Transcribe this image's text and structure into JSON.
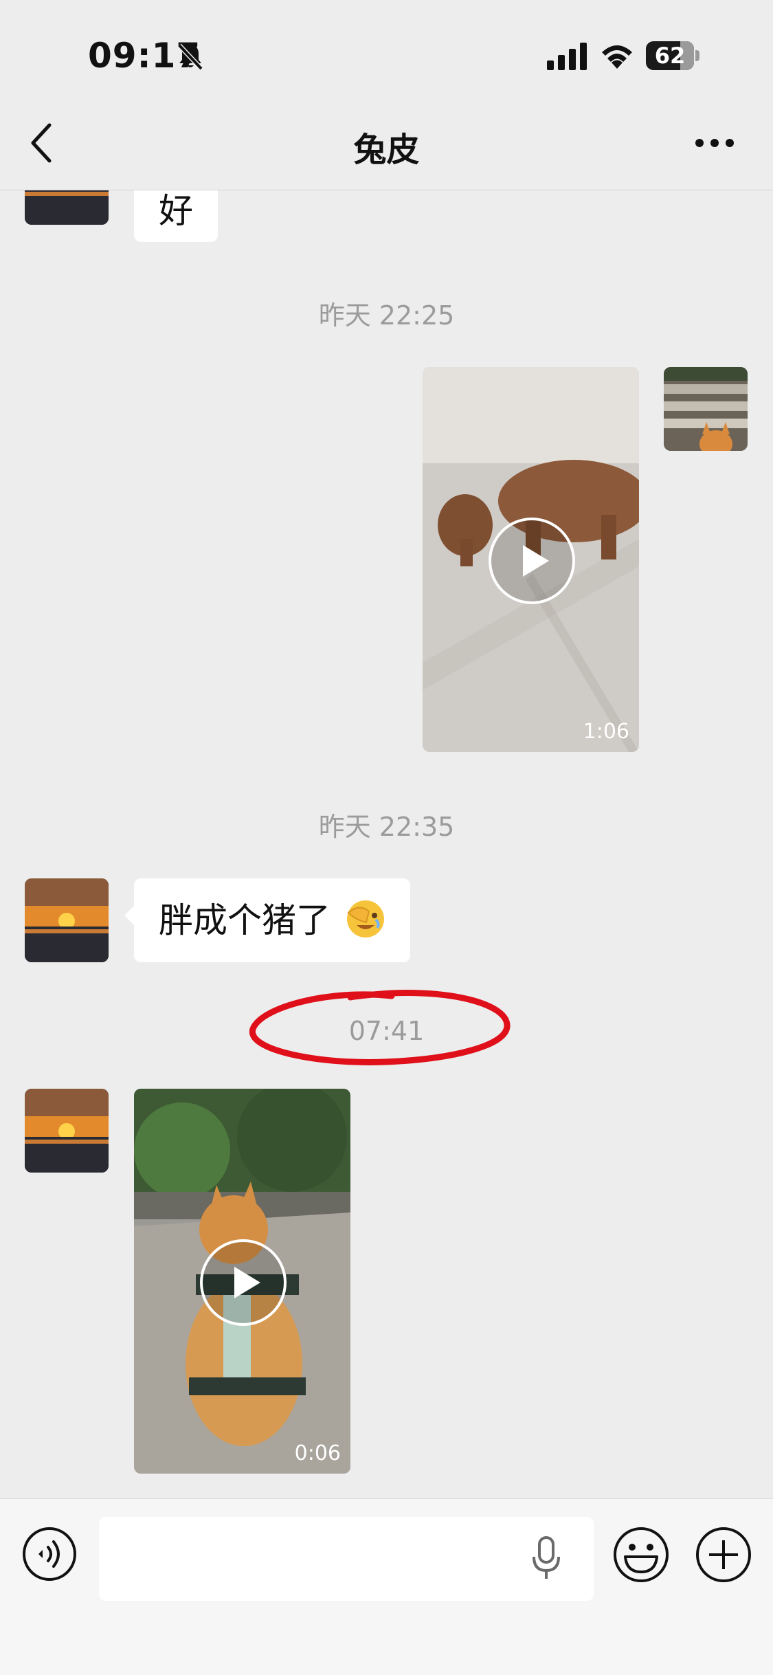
{
  "status_bar": {
    "time": "09:17",
    "battery": "62"
  },
  "header": {
    "title": "兔皮"
  },
  "messages": [
    {
      "type": "text",
      "side": "left",
      "text": "好"
    },
    {
      "type": "timestamp",
      "text": "昨天 22:25"
    },
    {
      "type": "video",
      "side": "right",
      "duration": "1:06"
    },
    {
      "type": "timestamp",
      "text": "昨天 22:35"
    },
    {
      "type": "text",
      "side": "left",
      "text": "胖成个猪了"
    },
    {
      "type": "timestamp",
      "text": "07:41"
    },
    {
      "type": "video",
      "side": "left",
      "duration": "0:06"
    }
  ],
  "input": {
    "placeholder": ""
  },
  "colors": {
    "background": "#ededed",
    "annotation_circle": "#e0101a",
    "bubble": "#ffffff"
  },
  "icons": [
    "bell-mute-icon",
    "signal-icon",
    "wifi-icon",
    "back-icon",
    "more-icon",
    "voice-icon",
    "mic-icon",
    "emoji-icon",
    "plus-icon",
    "play-icon"
  ]
}
